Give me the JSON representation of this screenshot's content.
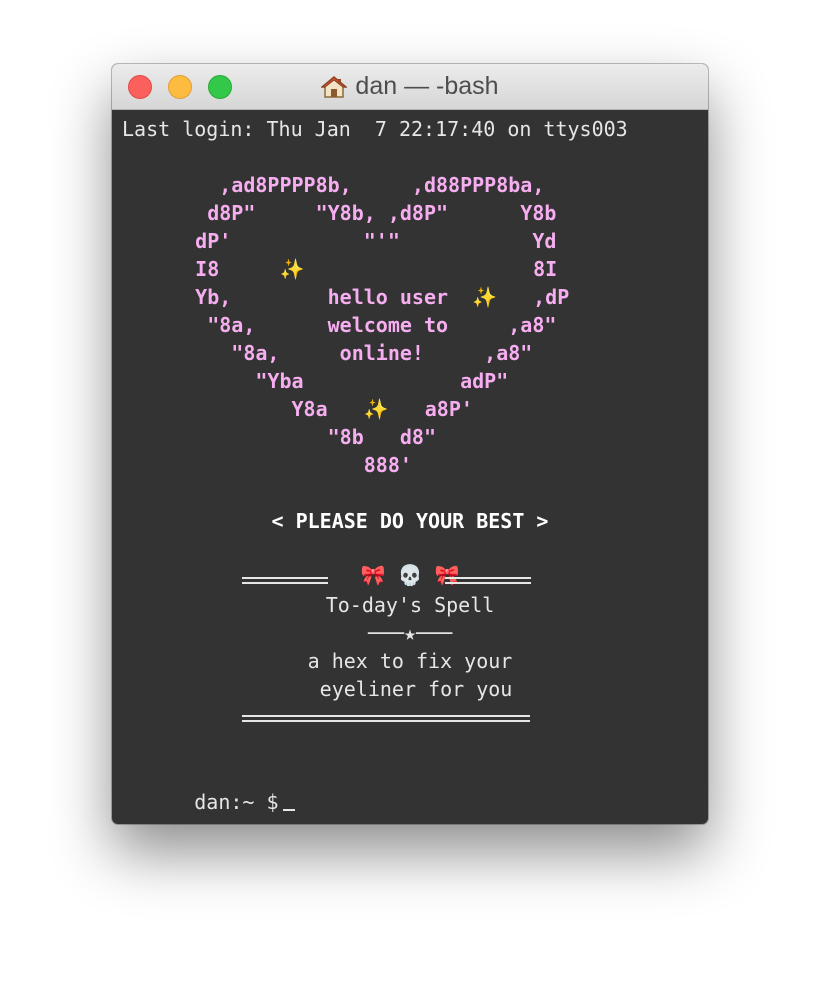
{
  "window": {
    "title": "dan — -bash",
    "title_icon": "home-icon",
    "traffic_lights": {
      "close": "#fc605c",
      "minimize": "#fdbc40",
      "zoom": "#34c84a"
    }
  },
  "terminal": {
    "background": "#333333",
    "last_login": "Last login: Thu Jan  7 22:17:40 on ttys003",
    "ascii_heart": [
      "      ,ad8PPPP8b,     ,d88PPP8ba,",
      "     d8P\"     \"Y8b, ,d8P\"      Y8b",
      "    dP'           \"'\"           Yd",
      "    I8     ✨                   8I",
      "    Yb,        hello user  ✨   ,dP",
      "     \"8a,      welcome to     ,a8\"",
      "       \"8a,     online!     ,a8\"",
      "         \"Yba             adP\"",
      "            Y8a   ✨   a8P'",
      "               \"8b   d8\"",
      "                  888'"
    ],
    "motto": "< PLEASE DO YOUR BEST >",
    "spell_header_emojis": "🎀 💀 🎀",
    "spell_title": "To-day's Spell",
    "spell_divider": "───★───",
    "spell_lines": [
      "a hex to fix your",
      " eyeliner for you"
    ],
    "prompt": "dan:~ $"
  },
  "colors": {
    "ascii_pink": "#f6aef0",
    "text": "#e6e6e6"
  }
}
